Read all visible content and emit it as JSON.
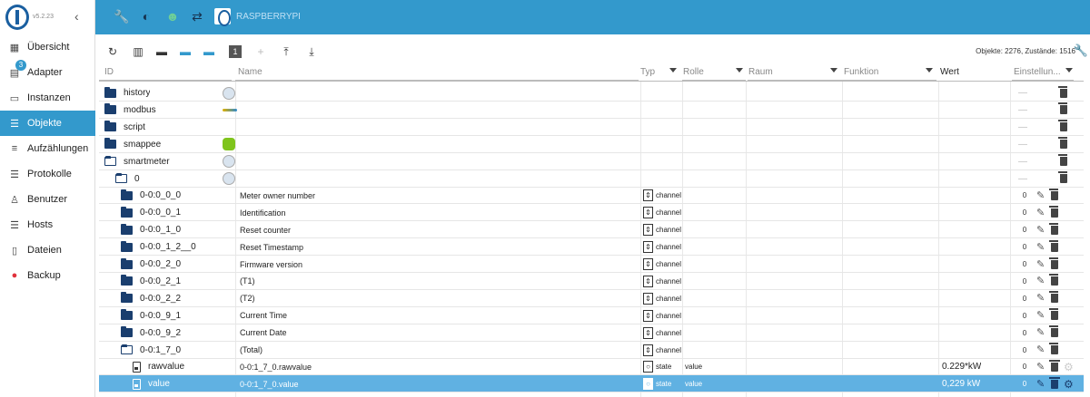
{
  "app": {
    "version": "v5.2.23",
    "host": "RASPBERRYPI"
  },
  "sidebar": {
    "adapter_badge": "3",
    "items": [
      {
        "label": "Übersicht",
        "icon": "grid-icon",
        "glyph": "▦"
      },
      {
        "label": "Adapter",
        "icon": "store-icon",
        "glyph": "▤"
      },
      {
        "label": "Instanzen",
        "icon": "instances-icon",
        "glyph": "▭"
      },
      {
        "label": "Objekte",
        "icon": "list-icon",
        "glyph": "☰",
        "active": true
      },
      {
        "label": "Aufzählungen",
        "icon": "enum-icon",
        "glyph": "≡"
      },
      {
        "label": "Protokolle",
        "icon": "log-icon",
        "glyph": "☰"
      },
      {
        "label": "Benutzer",
        "icon": "user-icon",
        "glyph": "♙"
      },
      {
        "label": "Hosts",
        "icon": "hosts-icon",
        "glyph": "☰"
      },
      {
        "label": "Dateien",
        "icon": "files-icon",
        "glyph": "▯"
      },
      {
        "label": "Backup",
        "icon": "backup-icon",
        "glyph": "●"
      }
    ]
  },
  "toolbar": {
    "object_count": "Objekte: 2276, Zustände: 1516"
  },
  "columns": {
    "id": "ID",
    "name": "Name",
    "type": "Typ",
    "role": "Rolle",
    "room": "Raum",
    "function": "Funktion",
    "value": "Wert",
    "settings": "Einstellun..."
  },
  "rows": [
    {
      "id": "history",
      "level": 0,
      "kind": "folder",
      "rowicon": "clock",
      "settings": "dash"
    },
    {
      "id": "modbus",
      "level": 0,
      "kind": "folder",
      "rowicon": "modbus",
      "settings": "dash"
    },
    {
      "id": "script",
      "level": 0,
      "kind": "folder",
      "settings": "dash"
    },
    {
      "id": "smappee",
      "level": 0,
      "kind": "folder",
      "rowicon": "green",
      "settings": "dash"
    },
    {
      "id": "smartmeter",
      "level": 0,
      "kind": "folder-open",
      "rowicon": "meter",
      "settings": "dash"
    },
    {
      "id": "0",
      "level": 1,
      "kind": "folder-open",
      "rowicon": "meter",
      "settings": "dash"
    },
    {
      "id": "0-0:0_0_0",
      "level": 2,
      "kind": "folder",
      "name": "Meter owner number",
      "type": "channel",
      "settings": "edit",
      "count": "0"
    },
    {
      "id": "0-0:0_0_1",
      "level": 2,
      "kind": "folder",
      "name": "Identification",
      "type": "channel",
      "settings": "edit",
      "count": "0"
    },
    {
      "id": "0-0:0_1_0",
      "level": 2,
      "kind": "folder",
      "name": "Reset counter",
      "type": "channel",
      "settings": "edit",
      "count": "0"
    },
    {
      "id": "0-0:0_1_2__0",
      "level": 2,
      "kind": "folder",
      "name": "Reset Timestamp",
      "type": "channel",
      "settings": "edit",
      "count": "0"
    },
    {
      "id": "0-0:0_2_0",
      "level": 2,
      "kind": "folder",
      "name": "Firmware version",
      "type": "channel",
      "settings": "edit",
      "count": "0"
    },
    {
      "id": "0-0:0_2_1",
      "level": 2,
      "kind": "folder",
      "name": "(T1)",
      "type": "channel",
      "settings": "edit",
      "count": "0"
    },
    {
      "id": "0-0:0_2_2",
      "level": 2,
      "kind": "folder",
      "name": "(T2)",
      "type": "channel",
      "settings": "edit",
      "count": "0"
    },
    {
      "id": "0-0:0_9_1",
      "level": 2,
      "kind": "folder",
      "name": "Current Time",
      "type": "channel",
      "settings": "edit",
      "count": "0"
    },
    {
      "id": "0-0:0_9_2",
      "level": 2,
      "kind": "folder",
      "name": "Current Date",
      "type": "channel",
      "settings": "edit",
      "count": "0"
    },
    {
      "id": "0-0:1_7_0",
      "level": 2,
      "kind": "folder-open",
      "name": "(Total)",
      "type": "channel",
      "settings": "edit",
      "count": "0"
    },
    {
      "id": "rawvalue",
      "level": 3,
      "kind": "file",
      "name": "0-0:1_7_0.rawvalue",
      "type": "state",
      "role": "value",
      "value": "0.229*kW",
      "settings": "edit-gear",
      "count": "0"
    },
    {
      "id": "value",
      "level": 3,
      "kind": "file",
      "name": "0-0:1_7_0.value",
      "type": "state",
      "role": "value",
      "value": "0,229 kW",
      "settings": "edit-gear",
      "count": "0",
      "selected": true
    }
  ]
}
